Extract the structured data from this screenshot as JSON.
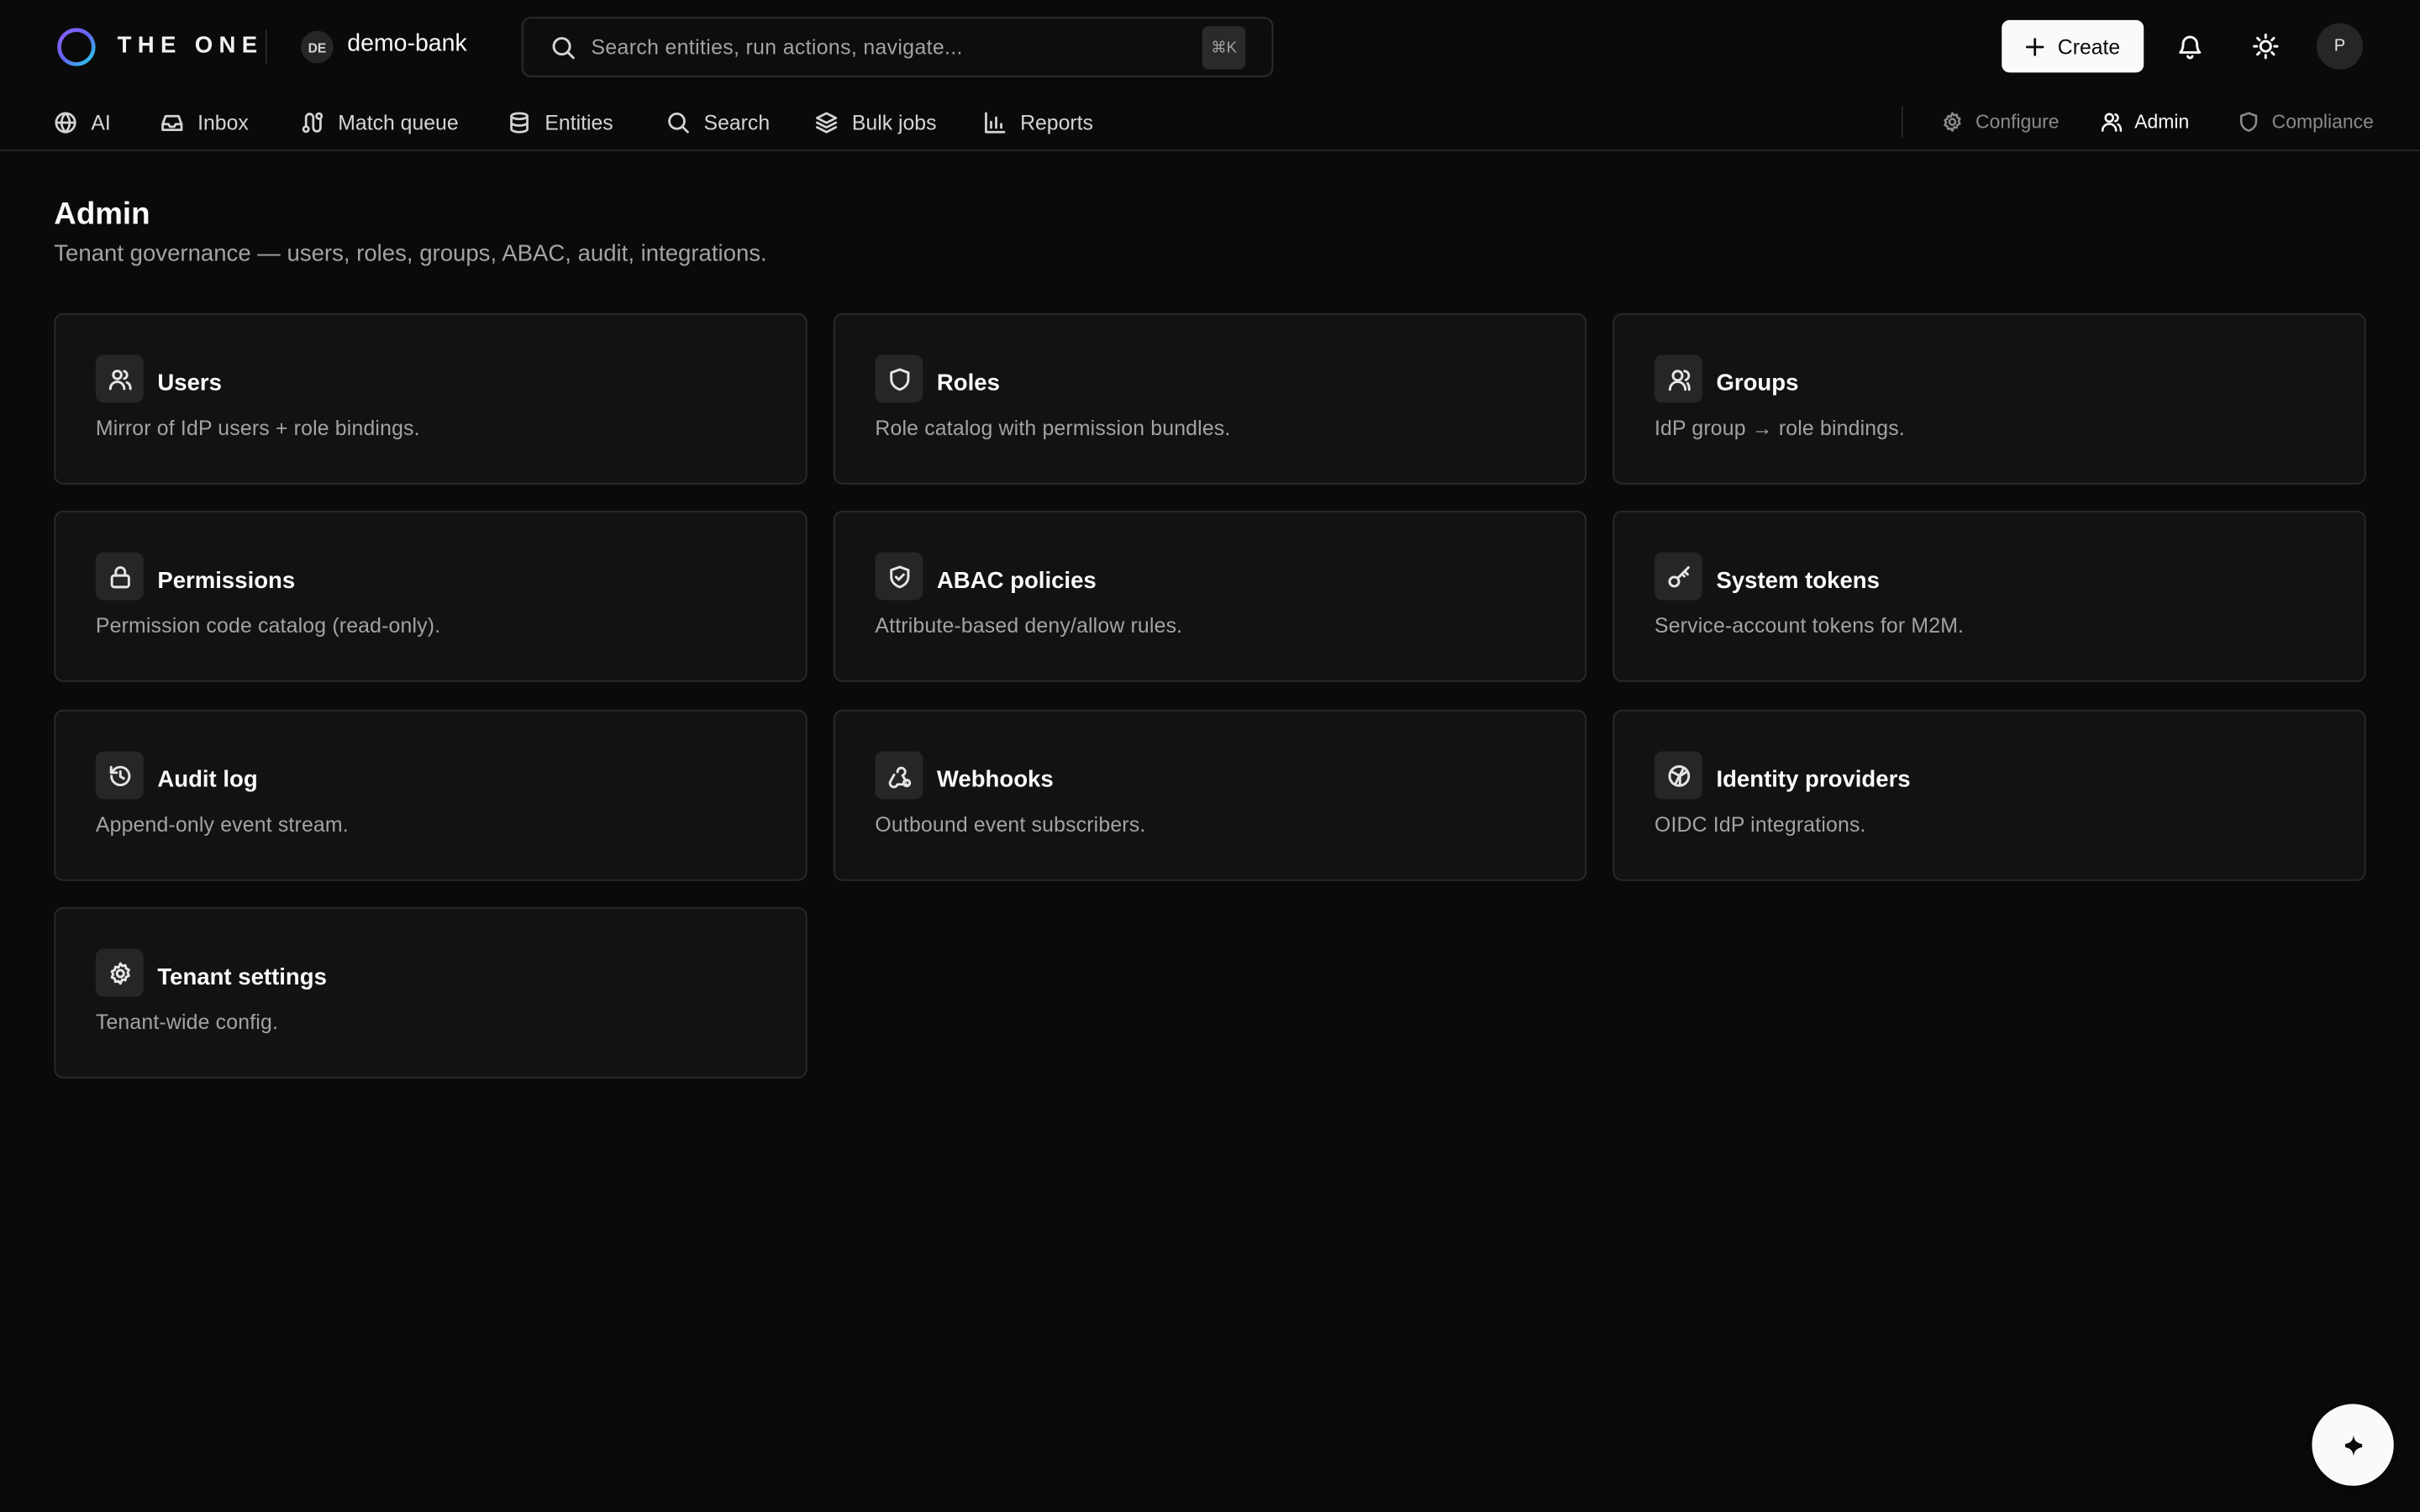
{
  "app": {
    "brand": "THE ONE",
    "tenant_badge": "DE",
    "tenant_name": "demo-bank"
  },
  "search": {
    "placeholder": "Search entities, run actions, navigate...",
    "shortcut": "⌘K"
  },
  "header": {
    "create_label": "Create",
    "avatar_initial": "P"
  },
  "nav": {
    "items": [
      {
        "label": "AI",
        "icon": "globe-icon"
      },
      {
        "label": "Inbox",
        "icon": "inbox-icon"
      },
      {
        "label": "Match queue",
        "icon": "route-icon"
      },
      {
        "label": "Entities",
        "icon": "database-icon"
      },
      {
        "label": "Search",
        "icon": "search-icon"
      },
      {
        "label": "Bulk jobs",
        "icon": "layers-icon"
      },
      {
        "label": "Reports",
        "icon": "bar-chart-icon"
      }
    ],
    "right": [
      {
        "label": "Configure",
        "icon": "gear-icon"
      },
      {
        "label": "Admin",
        "icon": "user-icon",
        "active": true
      },
      {
        "label": "Compliance",
        "icon": "shield-icon"
      }
    ]
  },
  "page": {
    "title": "Admin",
    "subtitle": "Tenant governance — users, roles, groups, ABAC, audit, integrations."
  },
  "cards": [
    {
      "title": "Users",
      "desc": "Mirror of IdP users + role bindings.",
      "icon": "users-icon"
    },
    {
      "title": "Roles",
      "desc": "Role catalog with permission bundles.",
      "icon": "shield-icon"
    },
    {
      "title": "Groups",
      "desc": "IdP group → role bindings.",
      "icon": "group-icon"
    },
    {
      "title": "Permissions",
      "desc": "Permission code catalog (read-only).",
      "icon": "lock-icon"
    },
    {
      "title": "ABAC policies",
      "desc": "Attribute-based deny/allow rules.",
      "icon": "shield-check-icon"
    },
    {
      "title": "System tokens",
      "desc": "Service-account tokens for M2M.",
      "icon": "key-icon"
    },
    {
      "title": "Audit log",
      "desc": "Append-only event stream.",
      "icon": "history-icon"
    },
    {
      "title": "Webhooks",
      "desc": "Outbound event subscribers.",
      "icon": "webhook-icon"
    },
    {
      "title": "Identity providers",
      "desc": "OIDC IdP integrations.",
      "icon": "fingerprint-icon"
    },
    {
      "title": "Tenant settings",
      "desc": "Tenant-wide config.",
      "icon": "gear-icon"
    }
  ],
  "colors": {
    "background": "#0a0a0a",
    "card": "#121212",
    "border": "#2a2a2a",
    "text": "#fafafa",
    "muted": "#a3a3a3"
  }
}
